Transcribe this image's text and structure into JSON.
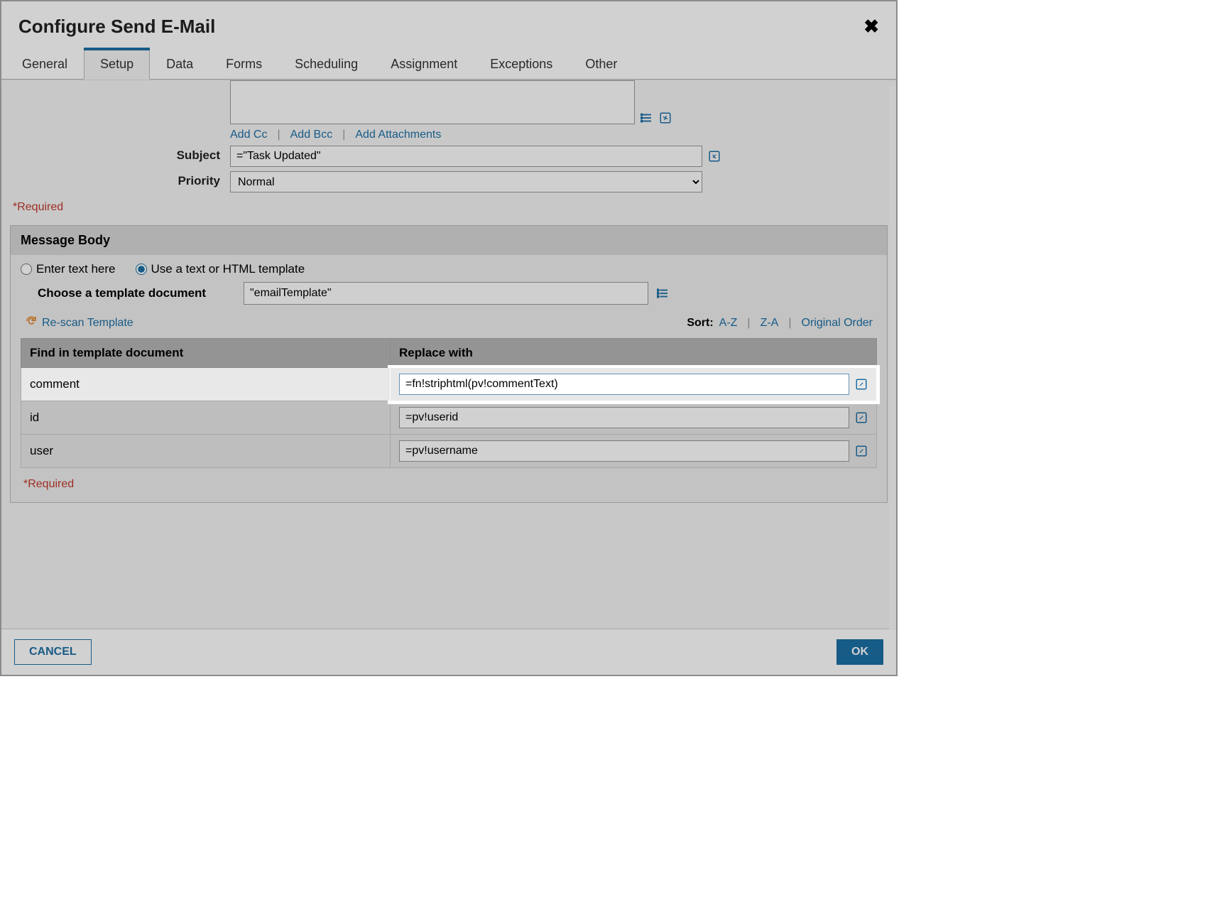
{
  "modal": {
    "title": "Configure Send E-Mail"
  },
  "tabs": [
    "General",
    "Setup",
    "Data",
    "Forms",
    "Scheduling",
    "Assignment",
    "Exceptions",
    "Other"
  ],
  "activeTab": "Setup",
  "links": {
    "addCc": "Add Cc",
    "addBcc": "Add Bcc",
    "addAttachments": "Add Attachments",
    "rescan": "Re-scan Template"
  },
  "fields": {
    "subjectLabel": "Subject",
    "subjectValue": "=\"Task Updated\"",
    "priorityLabel": "Priority",
    "priorityValue": "Normal"
  },
  "requiredNote": "*Required",
  "messageBody": {
    "title": "Message Body",
    "optText": "Enter text here",
    "optTemplate": "Use a text or HTML template",
    "chooseLabel": "Choose a template document",
    "chooseValue": "\"emailTemplate\""
  },
  "sort": {
    "label": "Sort:",
    "az": "A-Z",
    "za": "Z-A",
    "orig": "Original Order"
  },
  "tableHeaders": {
    "find": "Find in template document",
    "replace": "Replace with"
  },
  "vars": [
    {
      "name": "comment",
      "value": "=fn!striphtml(pv!commentText)"
    },
    {
      "name": "id",
      "value": "=pv!userid"
    },
    {
      "name": "user",
      "value": "=pv!username"
    }
  ],
  "footer": {
    "cancel": "CANCEL",
    "ok": "OK"
  }
}
